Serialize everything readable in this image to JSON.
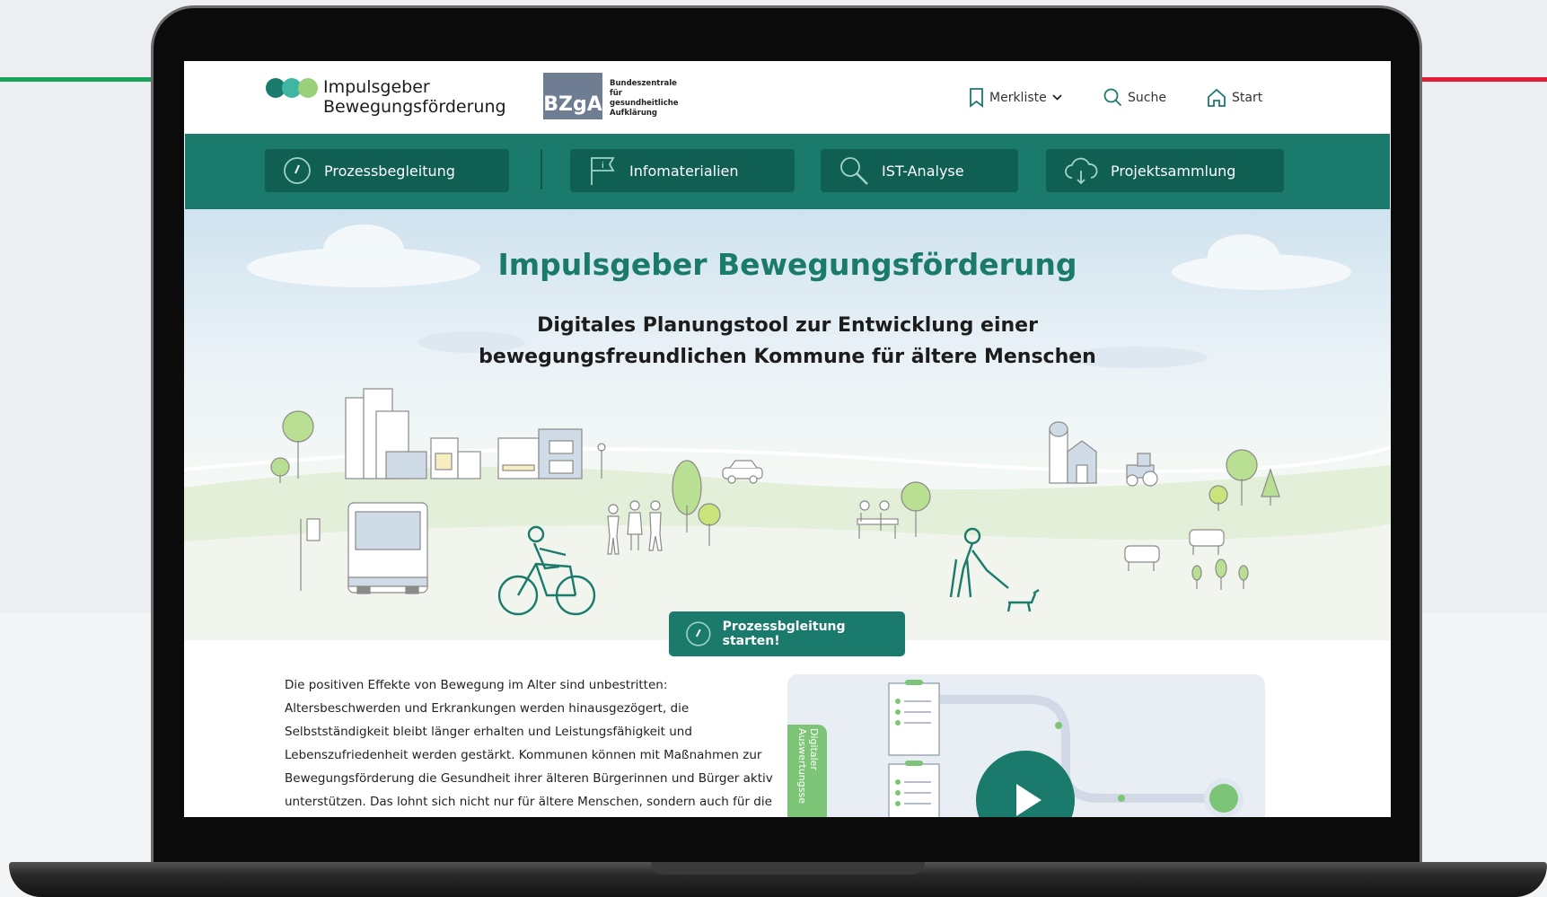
{
  "header": {
    "logo_line1": "Impulsgeber",
    "logo_line2": "Bewegungsförderung",
    "bzga_badge": "BZgA",
    "bzga_line1": "Bundeszentrale",
    "bzga_line2": "für",
    "bzga_line3": "gesundheitliche",
    "bzga_line4": "Aufklärung",
    "merkliste": "Merkliste",
    "suche": "Suche",
    "start": "Start",
    "icons": [
      "bookmark-icon",
      "chevron-down-icon",
      "search-icon",
      "home-icon"
    ]
  },
  "nav": {
    "items": [
      {
        "label": "Prozessbegleitung",
        "icon": "compass-icon"
      },
      {
        "label": "Infomaterialien",
        "icon": "flag-info-icon"
      },
      {
        "label": "IST-Analyse",
        "icon": "magnifier-icon"
      },
      {
        "label": "Projektsammlung",
        "icon": "cloud-icon"
      }
    ]
  },
  "hero": {
    "title": "Impulsgeber Bewegungsförderung",
    "subtitle_line1": "Digitales Planungstool zur Entwicklung einer",
    "subtitle_line2": "bewegungsfreundlichen Kommune für ältere Menschen",
    "cta_label": "Prozessbgleitung starten!"
  },
  "content": {
    "lines": [
      "Die positiven Effekte von Bewegung im Alter sind unbestritten:",
      "Altersbeschwerden und Erkrankungen werden hinausgezögert, die",
      "Selbstständigkeit bleibt länger erhalten und Leistungsfähigkeit und",
      "Lebenszufriedenheit werden gestärkt. Kommunen können mit Maßnahmen zur",
      "Bewegungsförderung die Gesundheit ihrer älteren Bürgerinnen und Bürger aktiv",
      "unterstützen. Das lohnt sich nicht nur für ältere Menschen, sondern auch für die"
    ],
    "video_tab_label": "Digitaler Auswertungsse"
  },
  "colors": {
    "primary": "#1a7a6b",
    "primary_dark": "#0f5f53",
    "accent_green": "#7cc576",
    "bg_stripe_left": "#1aa35a",
    "bg_stripe_right": "#e11d37"
  }
}
